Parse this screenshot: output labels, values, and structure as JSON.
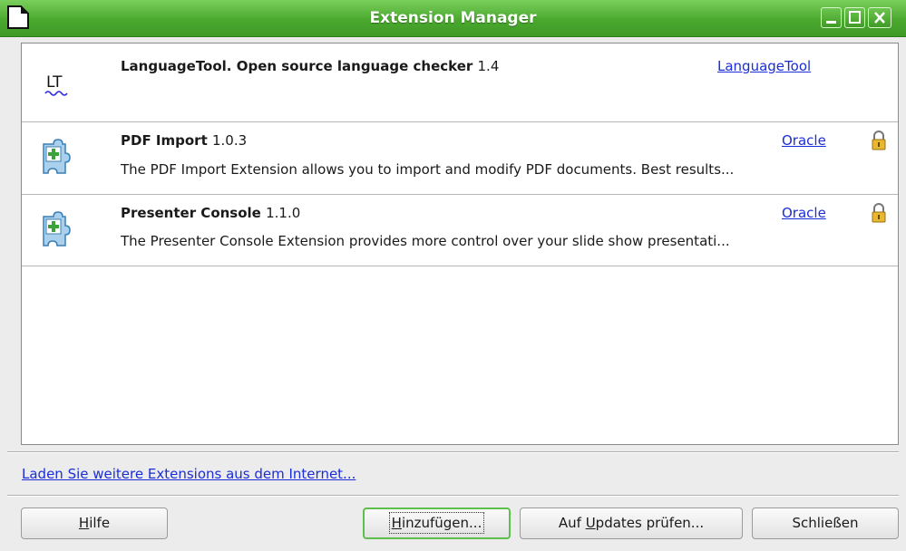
{
  "window": {
    "title": "Extension Manager"
  },
  "extensions": [
    {
      "name": "LanguageTool. Open source language checker",
      "version": "1.4",
      "publisher": "LanguageTool",
      "description": "",
      "icon": "languagetool-icon",
      "locked": false
    },
    {
      "name": "PDF Import",
      "version": "1.0.3",
      "publisher": "Oracle",
      "description": "The PDF Import Extension allows you to import and modify PDF documents. Best results...",
      "icon": "puzzle-extension-icon",
      "locked": true
    },
    {
      "name": "Presenter Console",
      "version": "1.1.0",
      "publisher": "Oracle",
      "description": "The Presenter Console Extension provides more control over your slide show presentati...",
      "icon": "puzzle-extension-icon",
      "locked": true
    }
  ],
  "more_link": "Laden Sie weitere Extensions aus dem Internet...",
  "buttons": {
    "help": {
      "pre": "",
      "mnemonic": "H",
      "post": "ilfe"
    },
    "add": {
      "pre": "",
      "mnemonic": "H",
      "post": "inzufügen..."
    },
    "updates": {
      "pre": "Auf ",
      "mnemonic": "U",
      "post": "pdates prüfen..."
    },
    "close": "Schließen"
  },
  "colors": {
    "titlebar": "#4aa82e",
    "link": "#1a2dd8",
    "focus": "#5ec04a"
  }
}
